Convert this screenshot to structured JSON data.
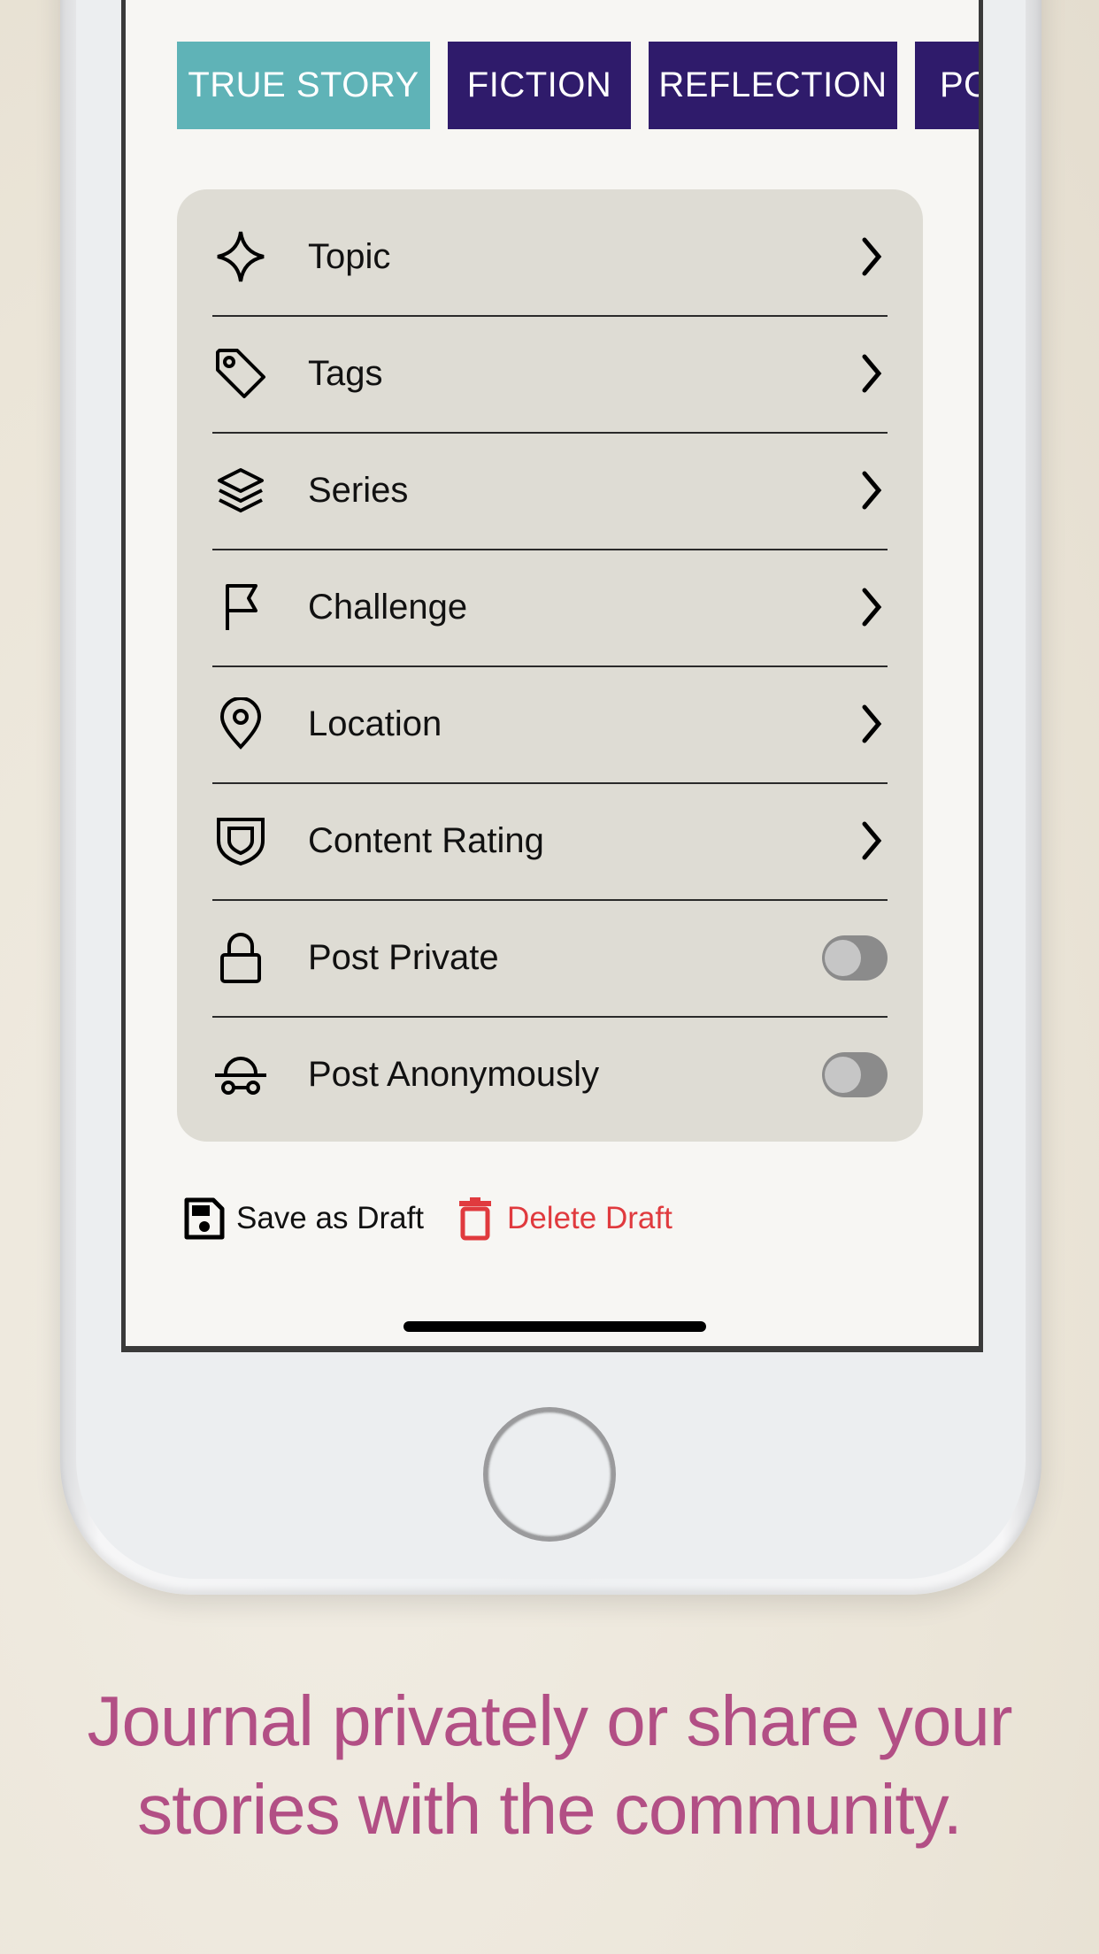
{
  "categories": {
    "items": [
      {
        "label": "TRUE STORY",
        "selected": true,
        "color": "#5fb3b7"
      },
      {
        "label": "FICTION",
        "selected": false,
        "color": "#2f1b6b"
      },
      {
        "label": "REFLECTION",
        "selected": false,
        "color": "#2f1b6b"
      },
      {
        "label": "PO",
        "selected": false,
        "color": "#2f1b6b"
      }
    ]
  },
  "settings": {
    "items": [
      {
        "label": "Topic",
        "icon": "sparkle-icon",
        "control": "chevron"
      },
      {
        "label": "Tags",
        "icon": "tag-icon",
        "control": "chevron"
      },
      {
        "label": "Series",
        "icon": "layers-icon",
        "control": "chevron"
      },
      {
        "label": "Challenge",
        "icon": "flag-icon",
        "control": "chevron"
      },
      {
        "label": "Location",
        "icon": "map-pin-icon",
        "control": "chevron"
      },
      {
        "label": "Content Rating",
        "icon": "shield-icon",
        "control": "chevron"
      },
      {
        "label": "Post Private",
        "icon": "lock-icon",
        "control": "toggle",
        "on": false
      },
      {
        "label": "Post Anonymously",
        "icon": "incognito-icon",
        "control": "toggle",
        "on": false
      }
    ]
  },
  "actions": {
    "save_label": "Save as Draft",
    "delete_label": "Delete Draft",
    "delete_color": "#e03a3e"
  },
  "caption": {
    "line1": "Journal privately or share your",
    "line2": "stories with the community."
  }
}
